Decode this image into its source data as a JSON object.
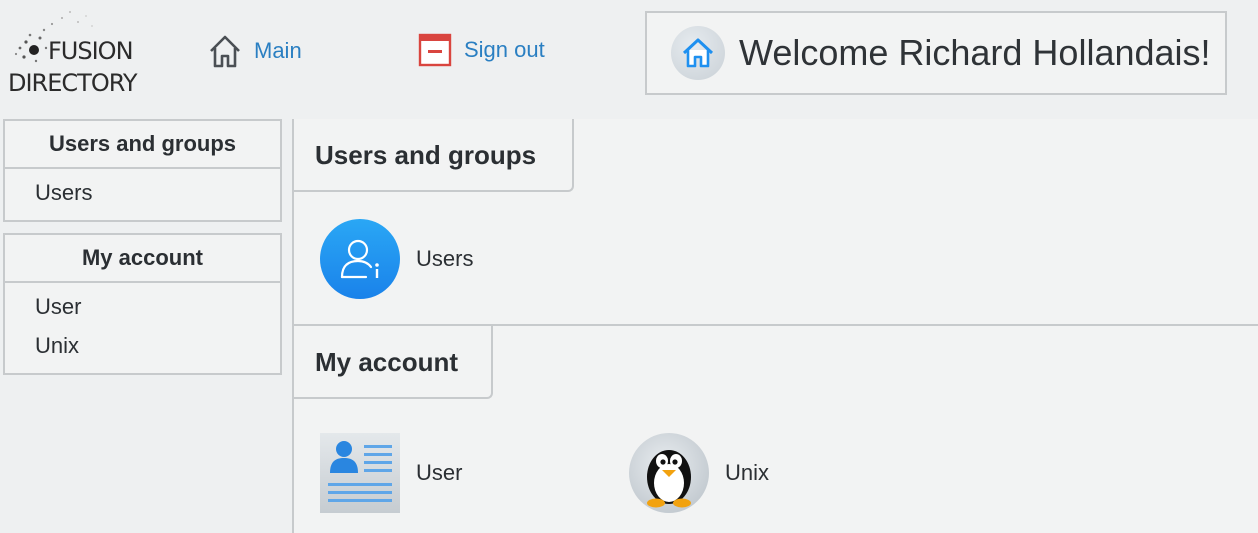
{
  "header": {
    "logo": {
      "line1": "FUSION",
      "line2": "DIRECTORY"
    },
    "nav": {
      "main_label": "Main",
      "signout_label": "Sign out"
    },
    "welcome_text": "Welcome Richard Hollandais!"
  },
  "sidebar": {
    "groups": [
      {
        "title": "Users and groups",
        "items": [
          {
            "label": "Users"
          }
        ]
      },
      {
        "title": "My account",
        "items": [
          {
            "label": "User"
          },
          {
            "label": "Unix"
          }
        ]
      }
    ]
  },
  "main": {
    "sections": [
      {
        "title": "Users and groups",
        "tiles": [
          {
            "label": "Users",
            "icon": "user-info-icon"
          }
        ]
      },
      {
        "title": "My account",
        "tiles": [
          {
            "label": "User",
            "icon": "id-card-icon"
          },
          {
            "label": "Unix",
            "icon": "penguin-icon"
          }
        ]
      }
    ]
  },
  "colors": {
    "link": "#2a7fc2",
    "background": "#eef0f1",
    "panel": "#f2f3f3",
    "border": "#c7cacc",
    "users_icon": "#1e90f0",
    "signout_icon": "#d9453f"
  }
}
